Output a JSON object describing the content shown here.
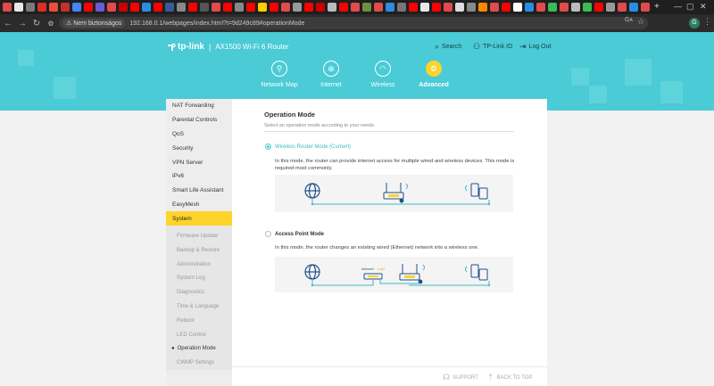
{
  "browser": {
    "tab_colors": [
      "#e04b4b",
      "#e8e8e8",
      "#7a7a7a",
      "#d93025",
      "#e94f3b",
      "#c4302b",
      "#4285f4",
      "#ff0000",
      "#6b5bd6",
      "#e04b4b",
      "#cc0000",
      "#ff0000",
      "#2a8de1",
      "#ff0000",
      "#3b5998",
      "#888888",
      "#ff0000",
      "#555555",
      "#e04b4b",
      "#ff0000",
      "#888888",
      "#ff0000",
      "#ffcc00",
      "#ff0000",
      "#e04b4b",
      "#999999",
      "#ff0000",
      "#cc0000",
      "#bbbbbb",
      "#ff0000",
      "#e04b4b",
      "#6f8f3f",
      "#e04b4b",
      "#2a8de1",
      "#777777",
      "#ff0000",
      "#e8e8e8",
      "#ff0000",
      "#e04b4b",
      "#dddddd",
      "#888888",
      "#ff8800",
      "#e04b4b",
      "#ff0000",
      "#ffffff",
      "#2a8de1",
      "#e04b4b",
      "#3cba54",
      "#e04b4b",
      "#bbbbbb",
      "#3cba54",
      "#ff0000",
      "#999999",
      "#e04b4b",
      "#2a8de1",
      "#e04b4b"
    ],
    "security_chip": "Nem biztonságos",
    "url": "192.168.0.1/webpages/index.html?t=9d249c89#operationMode",
    "profile_initial": "G"
  },
  "header": {
    "brand": "tp-link",
    "model": "AX1500 Wi-Fi 6 Router",
    "links": [
      {
        "label": "Search",
        "icon": "search-icon"
      },
      {
        "label": "TP-Link ID",
        "icon": "user-icon"
      },
      {
        "label": "Log Out",
        "icon": "logout-icon"
      }
    ],
    "nav": [
      {
        "label": "Network Map",
        "icon": "network-map-icon",
        "active": false
      },
      {
        "label": "Internet",
        "icon": "globe-icon",
        "active": false
      },
      {
        "label": "Wireless",
        "icon": "wifi-icon",
        "active": false
      },
      {
        "label": "Advanced",
        "icon": "gear-icon",
        "active": true
      }
    ]
  },
  "sidebar": {
    "items": [
      "NAT Forwarding",
      "Parental Controls",
      "QoS",
      "Security",
      "VPN Server",
      "IPv6",
      "Smart Life Assistant",
      "EasyMesh",
      "System"
    ],
    "active_item": "System",
    "sub_items": [
      "Firmware Update",
      "Backup & Restore",
      "Administration",
      "System Log",
      "Diagnostics",
      "Time & Language",
      "Reboot",
      "LED Control",
      "Operation Mode",
      "CWMP Settings"
    ],
    "active_sub_item": "Operation Mode"
  },
  "content": {
    "title": "Operation Mode",
    "description": "Select an operation mode according to your needs.",
    "modes": [
      {
        "label": "Wireless Router Mode (Current)",
        "selected": true,
        "text": "In this mode, the router can provide internet access for multiple wired and wireless devices. This mode is required most commonly."
      },
      {
        "label": "Access Point Mode",
        "selected": false,
        "text": "In this mode, the router changes an existing wired (Ethernet) network into a wireless one.",
        "diagram_labels": [
          "Internet",
          "LAN"
        ]
      }
    ]
  },
  "footer": {
    "support": "SUPPORT",
    "back_to_top": "BACK TO TOP"
  },
  "colors": {
    "hero": "#4acbd6",
    "accent_yellow": "#ffd42a",
    "diagram_line": "#3fb8c4",
    "diagram_icon": "#1e4f8a"
  }
}
